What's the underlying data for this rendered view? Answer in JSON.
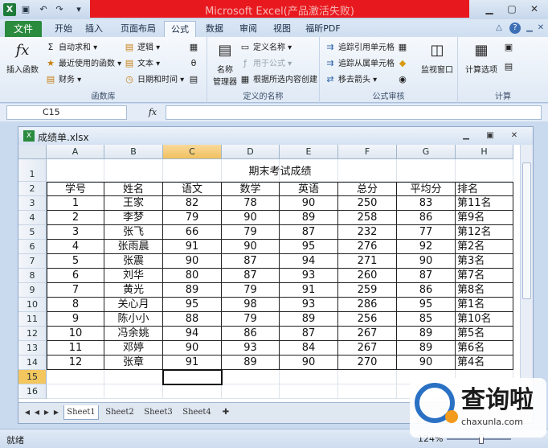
{
  "window": {
    "title": "Microsoft Excel(产品激活失败)",
    "quick_access": [
      "save-icon",
      "undo-icon",
      "redo-icon",
      "customize-icon"
    ],
    "controls": [
      "minimize-icon",
      "maximize-icon",
      "close-icon"
    ]
  },
  "tabs": {
    "file": "文件",
    "items": [
      "开始",
      "插入",
      "页面布局",
      "公式",
      "数据",
      "审阅",
      "视图",
      "福昕PDF"
    ],
    "active": "公式"
  },
  "ribbon": {
    "function_library": {
      "label": "函数库",
      "insert_function": "插入函数",
      "autosum": "自动求和",
      "recent": "最近使用的函数",
      "financial": "财务",
      "logical": "逻辑",
      "text": "文本",
      "datetime": "日期和时间"
    },
    "defined_names": {
      "label": "定义的名称",
      "name_manager": "名称\n管理器",
      "name_manager_line1": "名称",
      "name_manager_line2": "管理器",
      "define_name": "定义名称",
      "use_in_formula": "用于公式",
      "create_from_selection": "根据所选内容创建"
    },
    "formula_auditing": {
      "label": "公式审核",
      "trace_precedents": "追踪引用单元格",
      "trace_dependents": "追踪从属单元格",
      "remove_arrows": "移去箭头",
      "watch_window": "监视窗口"
    },
    "calculation": {
      "label": "计算",
      "calc_options": "计算选项"
    }
  },
  "formula_bar": {
    "name_box": "C15",
    "fx": "fx",
    "value": ""
  },
  "workbook": {
    "filename": "成绩单.xlsx"
  },
  "sheet": {
    "columns": [
      "A",
      "B",
      "C",
      "D",
      "E",
      "F",
      "G",
      "H"
    ],
    "selected_column": "C",
    "row_numbers": [
      "1",
      "2",
      "3",
      "4",
      "5",
      "6",
      "7",
      "8",
      "9",
      "10",
      "11",
      "12",
      "13",
      "14",
      "15",
      "16"
    ],
    "selected_row": "15",
    "title": "期末考试成绩",
    "headers": [
      "学号",
      "姓名",
      "语文",
      "数学",
      "英语",
      "总分",
      "平均分",
      "排名"
    ],
    "rows": [
      [
        "1",
        "王家",
        "82",
        "78",
        "90",
        "250",
        "83",
        "第11名"
      ],
      [
        "2",
        "李梦",
        "79",
        "90",
        "89",
        "258",
        "86",
        "第9名"
      ],
      [
        "3",
        "张飞",
        "66",
        "79",
        "87",
        "232",
        "77",
        "第12名"
      ],
      [
        "4",
        "张雨晨",
        "91",
        "90",
        "95",
        "276",
        "92",
        "第2名"
      ],
      [
        "5",
        "张震",
        "90",
        "87",
        "94",
        "271",
        "90",
        "第3名"
      ],
      [
        "6",
        "刘华",
        "80",
        "87",
        "93",
        "260",
        "87",
        "第7名"
      ],
      [
        "7",
        "黄光",
        "89",
        "79",
        "91",
        "259",
        "86",
        "第8名"
      ],
      [
        "8",
        "关心月",
        "95",
        "98",
        "93",
        "286",
        "95",
        "第1名"
      ],
      [
        "9",
        "陈小小",
        "88",
        "79",
        "89",
        "256",
        "85",
        "第10名"
      ],
      [
        "10",
        "冯余姚",
        "94",
        "86",
        "87",
        "267",
        "89",
        "第5名"
      ],
      [
        "11",
        "邓婷",
        "90",
        "93",
        "84",
        "267",
        "89",
        "第6名"
      ],
      [
        "12",
        "张章",
        "91",
        "89",
        "90",
        "270",
        "90",
        "第4名"
      ]
    ],
    "sheet_tabs": [
      "Sheet1",
      "Sheet2",
      "Sheet3",
      "Sheet4"
    ],
    "active_sheet": "Sheet1"
  },
  "status": {
    "text": "就绪",
    "zoom": "124%"
  },
  "watermark": {
    "text": "查询啦",
    "url": "chaxunla.com"
  }
}
